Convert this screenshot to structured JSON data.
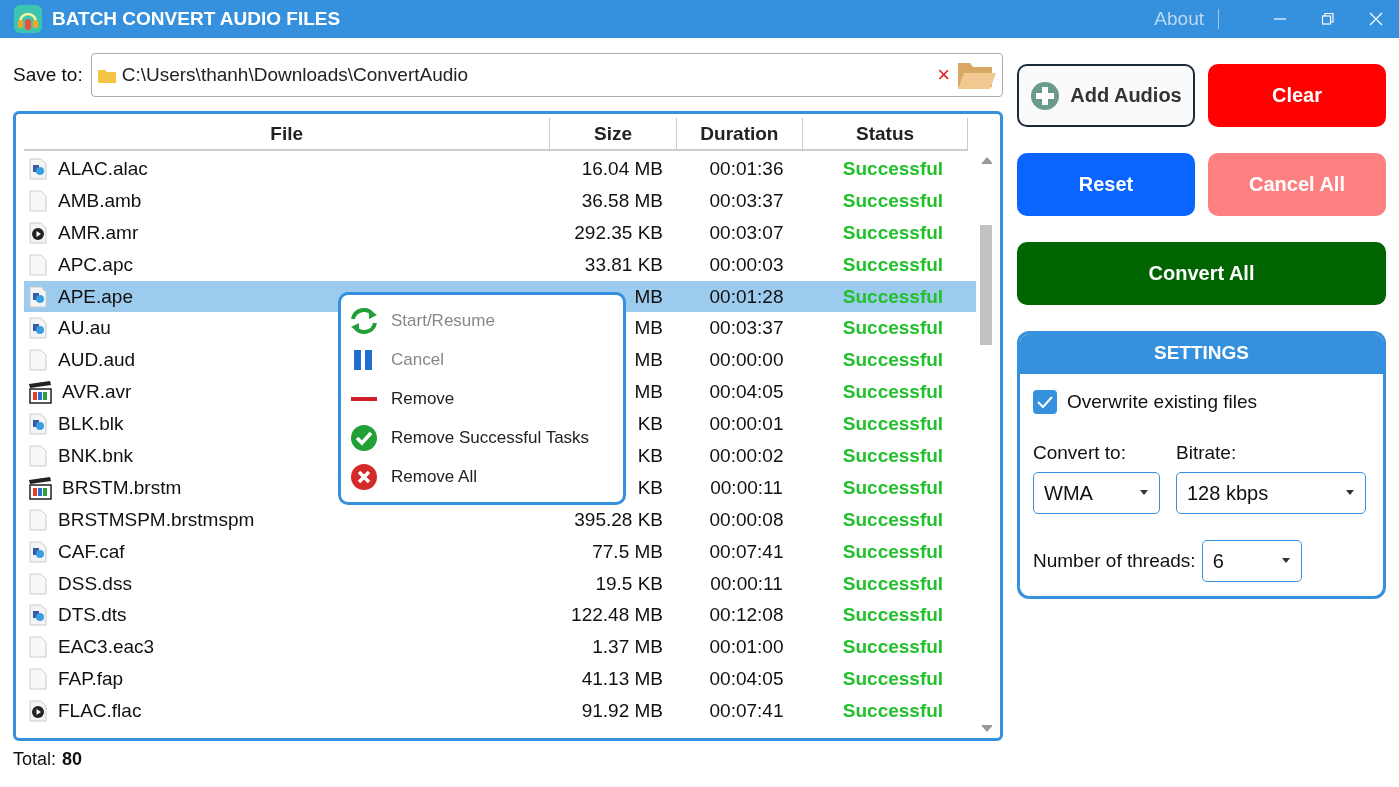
{
  "window": {
    "title": "BATCH CONVERT AUDIO FILES",
    "about": "About"
  },
  "save_to": {
    "label": "Save to:",
    "value": "C:\\Users\\thanh\\Downloads\\ConvertAudio",
    "clear": "×"
  },
  "table": {
    "columns": [
      "File",
      "Size",
      "Duration",
      "Status"
    ],
    "rows": [
      {
        "kind": "audio",
        "file": "ALAC.alac",
        "size": "16.04 MB",
        "duration": "00:01:36",
        "status": "Successful",
        "selected": false
      },
      {
        "kind": "blank",
        "file": "AMB.amb",
        "size": "36.58 MB",
        "duration": "00:03:37",
        "status": "Successful",
        "selected": false
      },
      {
        "kind": "play",
        "file": "AMR.amr",
        "size": "292.35 KB",
        "duration": "00:03:07",
        "status": "Successful",
        "selected": false
      },
      {
        "kind": "blank",
        "file": "APC.apc",
        "size": "33.81 KB",
        "duration": "00:00:03",
        "status": "Successful",
        "selected": false
      },
      {
        "kind": "audio",
        "file": "APE.ape",
        "size": "MB",
        "duration": "00:01:28",
        "status": "Successful",
        "selected": true
      },
      {
        "kind": "audio",
        "file": "AU.au",
        "size": "MB",
        "duration": "00:03:37",
        "status": "Successful",
        "selected": false
      },
      {
        "kind": "blank",
        "file": "AUD.aud",
        "size": "MB",
        "duration": "00:00:00",
        "status": "Successful",
        "selected": false
      },
      {
        "kind": "clapper",
        "file": "AVR.avr",
        "size": "MB",
        "duration": "00:04:05",
        "status": "Successful",
        "selected": false
      },
      {
        "kind": "audio",
        "file": "BLK.blk",
        "size": "KB",
        "duration": "00:00:01",
        "status": "Successful",
        "selected": false
      },
      {
        "kind": "blank",
        "file": "BNK.bnk",
        "size": "KB",
        "duration": "00:00:02",
        "status": "Successful",
        "selected": false
      },
      {
        "kind": "clapper",
        "file": "BRSTM.brstm",
        "size": "KB",
        "duration": "00:00:11",
        "status": "Successful",
        "selected": false
      },
      {
        "kind": "blank",
        "file": "BRSTMSPM.brstmspm",
        "size": "395.28 KB",
        "duration": "00:00:08",
        "status": "Successful",
        "selected": false
      },
      {
        "kind": "audio",
        "file": "CAF.caf",
        "size": "77.5 MB",
        "duration": "00:07:41",
        "status": "Successful",
        "selected": false
      },
      {
        "kind": "blank",
        "file": "DSS.dss",
        "size": "19.5 KB",
        "duration": "00:00:11",
        "status": "Successful",
        "selected": false
      },
      {
        "kind": "audio",
        "file": "DTS.dts",
        "size": "122.48 MB",
        "duration": "00:12:08",
        "status": "Successful",
        "selected": false
      },
      {
        "kind": "blank",
        "file": "EAC3.eac3",
        "size": "1.37 MB",
        "duration": "00:01:00",
        "status": "Successful",
        "selected": false
      },
      {
        "kind": "blank",
        "file": "FAP.fap",
        "size": "41.13 MB",
        "duration": "00:04:05",
        "status": "Successful",
        "selected": false
      },
      {
        "kind": "play",
        "file": "FLAC.flac",
        "size": "91.92 MB",
        "duration": "00:07:41",
        "status": "Successful",
        "selected": false
      }
    ]
  },
  "context_menu": [
    {
      "kind": "refresh",
      "label": "Start/Resume",
      "disabled": true
    },
    {
      "kind": "pause",
      "label": "Cancel",
      "disabled": true
    },
    {
      "kind": "minus",
      "label": "Remove",
      "disabled": false
    },
    {
      "kind": "check",
      "label": "Remove Successful Tasks",
      "disabled": false
    },
    {
      "kind": "cross",
      "label": "Remove All",
      "disabled": false
    }
  ],
  "total": {
    "label": "Total:",
    "value": "80"
  },
  "buttons": [
    {
      "kind": "add",
      "label": "Add Audios"
    },
    {
      "kind": "clear",
      "label": "Clear"
    },
    {
      "kind": "reset",
      "label": "Reset"
    },
    {
      "kind": "cancel",
      "label": "Cancel All"
    },
    {
      "kind": "convert",
      "label": "Convert All"
    }
  ],
  "settings": {
    "title": "SETTINGS",
    "overwrite": {
      "label": "Overwrite existing files",
      "checked": true
    },
    "convert_to": {
      "label": "Convert to:",
      "value": "WMA"
    },
    "bitrate": {
      "label": "Bitrate:",
      "value": "128 kbps"
    },
    "threads": {
      "label": "Number of threads:",
      "value": "6"
    }
  }
}
